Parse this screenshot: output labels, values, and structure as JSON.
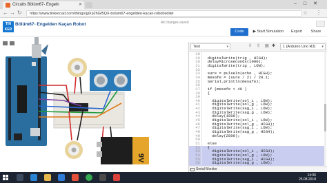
{
  "browser": {
    "tab_title": "Circuits Bölüm67- Engeln",
    "url": "https://www.tinkercad.com/things/giXp2hGf5QX-bolum67-engelden-kacan-robot/editel"
  },
  "header": {
    "project_name": "Bölüm67- Engelden Kaçan Robot",
    "save_status": "All changes saved",
    "code_label": "Code",
    "simulate_label": "Start Simulation",
    "export_label": "Export",
    "share_label": "Share"
  },
  "code_panel": {
    "mode": "Text",
    "board": "1 (Arduino Uno R3)",
    "serial_monitor": "Serial Monitor",
    "lines": [
      {
        "n": "28",
        "t": ""
      },
      {
        "n": "29",
        "t": "  digitalWrite(trig , HIGH);"
      },
      {
        "n": "30",
        "t": "  delayMicroseconds(1000);"
      },
      {
        "n": "31",
        "t": "  digitalWrite(trig , LOW);"
      },
      {
        "n": "32",
        "t": ""
      },
      {
        "n": "33",
        "t": "  sure = pulseIn(echo , HIGH);"
      },
      {
        "n": "34",
        "t": "  mesafe = (sure / 2) / 29.1;"
      },
      {
        "n": "35",
        "t": "  Serial.println(mesafe);"
      },
      {
        "n": "36",
        "t": ""
      },
      {
        "n": "37",
        "t": "  if (mesafe < 40 )"
      },
      {
        "n": "38",
        "t": "  {"
      },
      {
        "n": "39",
        "t": ""
      },
      {
        "n": "40",
        "t": "    digitalWrite(sol_i , LOW);"
      },
      {
        "n": "41",
        "t": "    digitalWrite(sol_g , LOW);"
      },
      {
        "n": "42",
        "t": "    digitalWrite(sag_i , LOW);"
      },
      {
        "n": "43",
        "t": "    digitalWrite(sag_g , LOW);"
      },
      {
        "n": "44",
        "t": "    delay(1500);"
      },
      {
        "n": "45",
        "t": "    digitalWrite(sol_i , LOW);"
      },
      {
        "n": "46",
        "t": "    digitalWrite(sol_g , HIGH);"
      },
      {
        "n": "47",
        "t": "    digitalWrite(sag_i , LOW);"
      },
      {
        "n": "48",
        "t": "    digitalWrite(sag_g , HIGH);"
      },
      {
        "n": "49",
        "t": "    delay(2500);"
      },
      {
        "n": "50",
        "t": ""
      },
      {
        "n": "51",
        "t": "  else"
      },
      {
        "n": "52",
        "t": "  {"
      },
      {
        "n": "53",
        "t": "    digitalWrite(sol_i , HIGH);"
      },
      {
        "n": "54",
        "t": "    digitalWrite(sol_g , LOW);"
      },
      {
        "n": "55",
        "t": "    digitalWrite(sag_i , HIGH);"
      },
      {
        "n": "56",
        "t": "    digitalWrite(sag_g , LOW);"
      }
    ],
    "selected_from": 24
  },
  "taskbar": {
    "time": "14:06",
    "date": "25.08.2018"
  },
  "canvas": {
    "battery_label": "9V"
  }
}
